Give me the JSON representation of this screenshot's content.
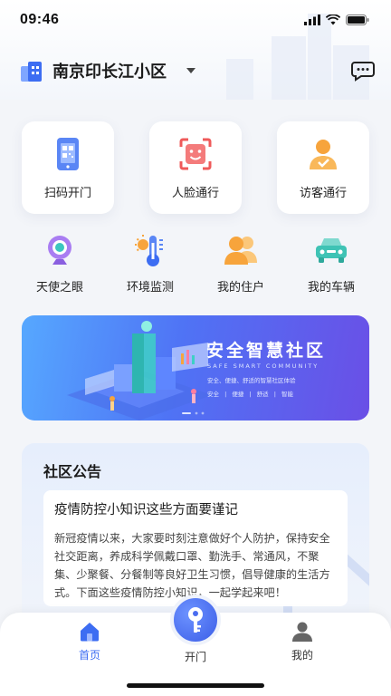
{
  "status": {
    "time": "09:46"
  },
  "header": {
    "community": "南京印长江小区"
  },
  "quick_actions": [
    {
      "label": "扫码开门",
      "icon": "qr-phone-icon"
    },
    {
      "label": "人脸通行",
      "icon": "face-scan-icon"
    },
    {
      "label": "访客通行",
      "icon": "visitor-icon"
    }
  ],
  "services": [
    {
      "label": "天使之眼",
      "icon": "camera-icon"
    },
    {
      "label": "环境监测",
      "icon": "thermometer-icon"
    },
    {
      "label": "我的住户",
      "icon": "residents-icon"
    },
    {
      "label": "我的车辆",
      "icon": "car-icon"
    }
  ],
  "banner": {
    "title": "安全智慧社区",
    "subtitle": "SAFE SMART COMMUNITY",
    "desc": "安全、便捷、舒适的智慧社区体验",
    "tags": "安全 | 便捷 | 舒适 | 智能"
  },
  "notice": {
    "title": "社区公告",
    "headline": "疫情防控小知识这些方面要谨记",
    "body": "新冠疫情以来，大家要时刻注意做好个人防护，保持安全社交距离，养成科学佩戴口罩、勤洗手、常通风，不聚集、少聚餐、分餐制等良好卫生习惯，倡导健康的生活方式。下面这些疫情防控小知识，一起学起来吧！"
  },
  "tabs": {
    "home": "首页",
    "open": "开门",
    "me": "我的"
  },
  "colors": {
    "accent": "#3d6df2",
    "orange": "#f7a43c",
    "red": "#ef5a5a",
    "teal": "#3fc3b5"
  }
}
